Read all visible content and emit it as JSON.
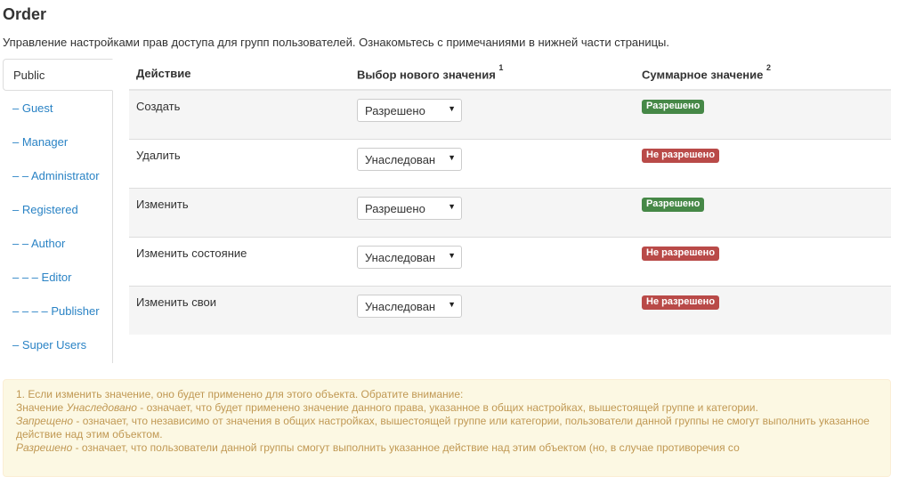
{
  "page": {
    "title": "Order",
    "description": "Управление настройками прав доступа для групп пользователей. Ознакомьтесь с примечаниями в нижней части страницы."
  },
  "tabs": [
    {
      "label": "Public",
      "active": true
    },
    {
      "label": "– Guest",
      "active": false
    },
    {
      "label": "– Manager",
      "active": false
    },
    {
      "label": "– – Administrator",
      "active": false
    },
    {
      "label": "– Registered",
      "active": false
    },
    {
      "label": "– – Author",
      "active": false
    },
    {
      "label": "– – – Editor",
      "active": false
    },
    {
      "label": "– – – – Publisher",
      "active": false
    },
    {
      "label": "– Super Users",
      "active": false
    }
  ],
  "table": {
    "headers": {
      "action": "Действие",
      "new_value": "Выбор нового значения",
      "new_value_sup": "1",
      "computed": "Суммарное значение",
      "computed_sup": "2"
    },
    "rows": [
      {
        "action": "Создать",
        "select": "Разрешено",
        "computed": "Разрешено",
        "status": "allowed"
      },
      {
        "action": "Удалить",
        "select": "Унаследован",
        "computed": "Не разрешено",
        "status": "denied"
      },
      {
        "action": "Изменить",
        "select": "Разрешено",
        "computed": "Разрешено",
        "status": "allowed"
      },
      {
        "action": "Изменить состояние",
        "select": "Унаследован",
        "computed": "Не разрешено",
        "status": "denied"
      },
      {
        "action": "Изменить свои",
        "select": "Унаследован",
        "computed": "Не разрешено",
        "status": "denied"
      }
    ],
    "caret": "▼"
  },
  "notes": {
    "line1": "1. Если изменить значение, оно будет применено для этого объекта. Обратите внимание:",
    "line2_em": "Унаследовано",
    "line2_pre": "Значение ",
    "line2_post": " - означает, что будет применено значение данного права, указанное в общих настройках, вышестоящей группе и категории.",
    "line3_em": "Запрещено",
    "line3_post": " - означает, что независимо от значения в общих настройках, вышестоящей группе или категории, пользователи данной группы не смогут выполнить указанное действие над этим объектом.",
    "line4_em": "Разрешено",
    "line4_post": " - означает, что пользователи данной группы смогут выполнить указанное действие над этим объектом (но, в случае противоречия со"
  },
  "colors": {
    "link": "#2a83c5",
    "allowed": "#468847",
    "denied": "#b94a48",
    "notes_bg": "#fcf8e3",
    "notes_text": "#c09853"
  }
}
